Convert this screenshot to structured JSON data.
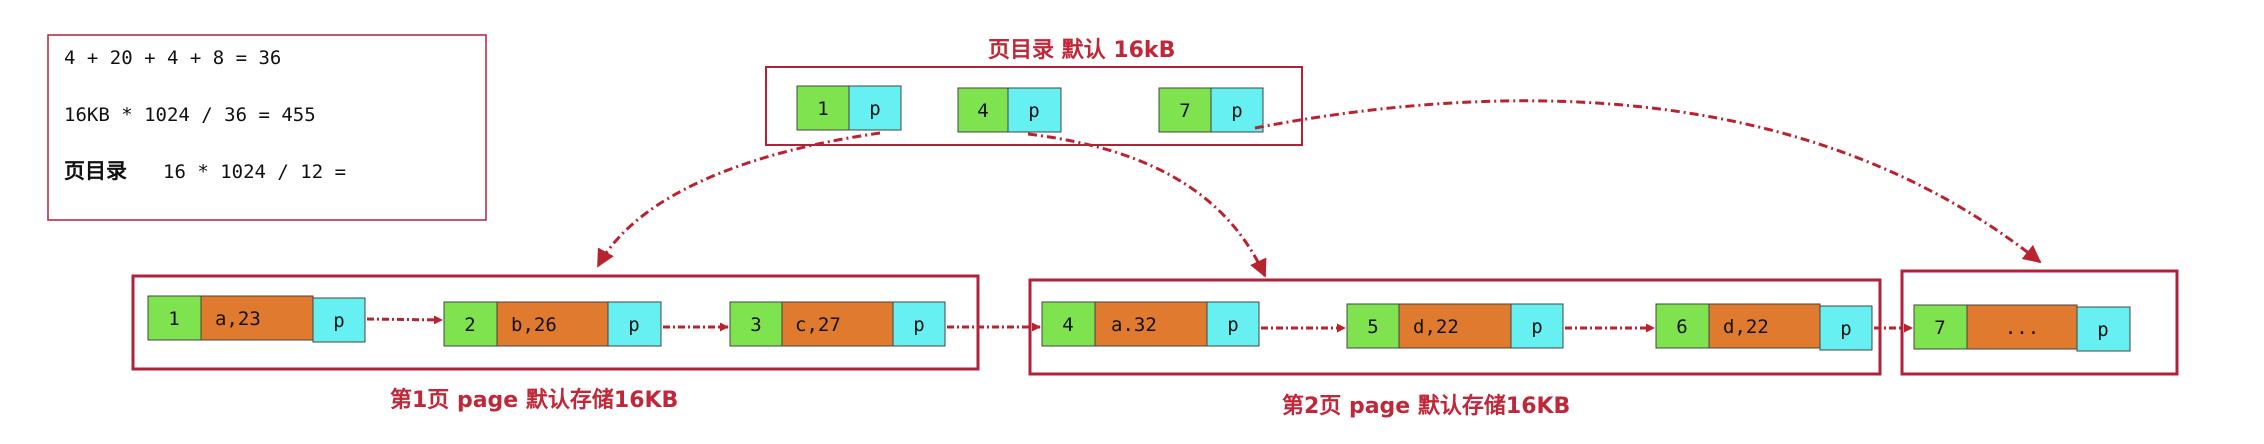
{
  "calc_note": {
    "line1": "4 + 20 + 4 + 8  =  36",
    "line2": "16KB * 1024 / 36 = 455",
    "line3_label": "页目录",
    "line3_expr": "16 * 1024 /  12 ="
  },
  "directory": {
    "title": "页目录 默认 16kB",
    "entries": [
      {
        "key": "1",
        "ptr": "p"
      },
      {
        "key": "4",
        "ptr": "p"
      },
      {
        "key": "7",
        "ptr": "p"
      }
    ]
  },
  "pages": [
    {
      "label": "第1页 page  默认存储16KB",
      "records": [
        {
          "id": "1",
          "value": "a,23",
          "ptr": "p"
        },
        {
          "id": "2",
          "value": "b,26",
          "ptr": "p"
        },
        {
          "id": "3",
          "value": "c,27",
          "ptr": "p"
        }
      ]
    },
    {
      "label": "第2页 page  默认存储16KB",
      "records": [
        {
          "id": "4",
          "value": "a.32",
          "ptr": "p"
        },
        {
          "id": "5",
          "value": "d,22",
          "ptr": "p"
        },
        {
          "id": "6",
          "value": "d,22",
          "ptr": "p"
        }
      ]
    },
    {
      "label": "",
      "records": [
        {
          "id": "7",
          "value": "...",
          "ptr": "p"
        }
      ]
    }
  ],
  "colors": {
    "frame": "#b0223a",
    "key_green": "#7ee34f",
    "value_orange": "#e07a2e",
    "ptr_cyan": "#66f0f2",
    "arrow": "#b8232f",
    "title_red": "#c0283a"
  }
}
